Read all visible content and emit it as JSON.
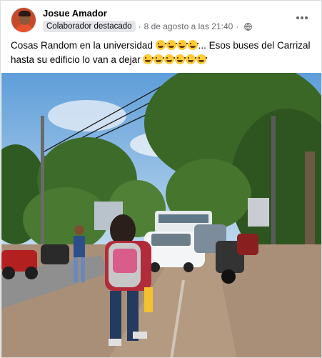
{
  "post": {
    "author": "Josue Amador",
    "badge": "Colaborador destacado",
    "separator": "·",
    "timestamp": "8 de agosto a las 21:40",
    "separator2": "·",
    "privacy_icon": "globe-icon",
    "more_icon": "more-options-icon",
    "text_line1": "Cosas Random en la universidad",
    "text_line1_tail": "... Esos buses del Carrizal",
    "text_line2": "hasta su edificio lo van a dejar",
    "emoji_icon": "laughing-emoji-icon",
    "emoji_count_line1": 4,
    "emoji_count_line2": 6
  },
  "colors": {
    "text": "#050505",
    "secondary": "#65676b",
    "badge_bg": "#e4e6eb",
    "sky": "#7fb6e8",
    "foliage": "#3d6b2a"
  }
}
